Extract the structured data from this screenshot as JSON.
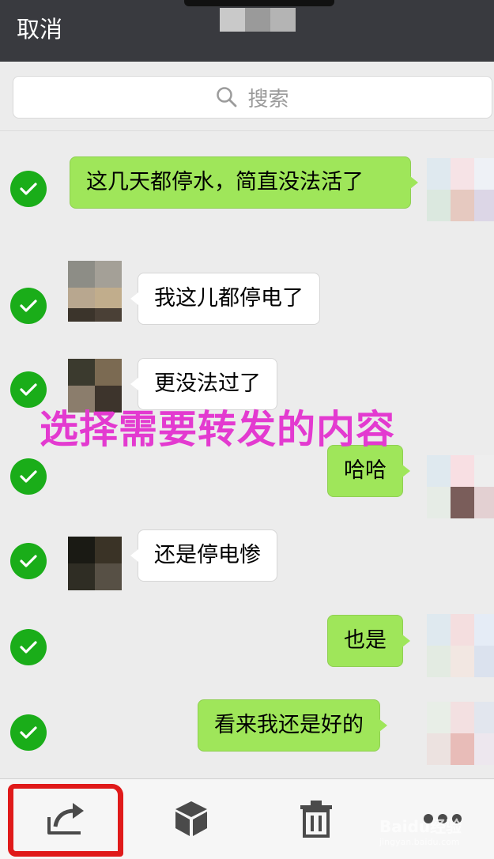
{
  "header": {
    "cancel_label": "取消"
  },
  "search": {
    "placeholder": "搜索"
  },
  "messages": [
    {
      "side": "me",
      "text": "这几天都停水，简直没法活了",
      "selected": true
    },
    {
      "side": "other",
      "text": "我这儿都停电了",
      "selected": true
    },
    {
      "side": "other",
      "text": "更没法过了",
      "selected": true
    },
    {
      "side": "me",
      "text": "哈哈",
      "selected": true
    },
    {
      "side": "other",
      "text": "还是停电惨",
      "selected": true
    },
    {
      "side": "me",
      "text": "也是",
      "selected": true
    },
    {
      "side": "me",
      "text": "看来我还是好的",
      "selected": true
    }
  ],
  "annotation": {
    "text": "选择需要转发的内容"
  },
  "toolbar": {
    "items": [
      {
        "icon": "share-icon",
        "label": ""
      },
      {
        "icon": "favorite-box-icon",
        "label": ""
      },
      {
        "icon": "trash-icon",
        "label": ""
      },
      {
        "icon": "more-icon",
        "label": ""
      }
    ]
  },
  "watermark": {
    "brand": "Baidu经验",
    "url": "jingyan.baidu.com"
  },
  "colors": {
    "titlebar": "#393a3f",
    "check_green": "#1aad19",
    "my_bubble": "#9fe65a",
    "annotation": "#e33ad0",
    "highlight_red": "#e01a1a"
  }
}
